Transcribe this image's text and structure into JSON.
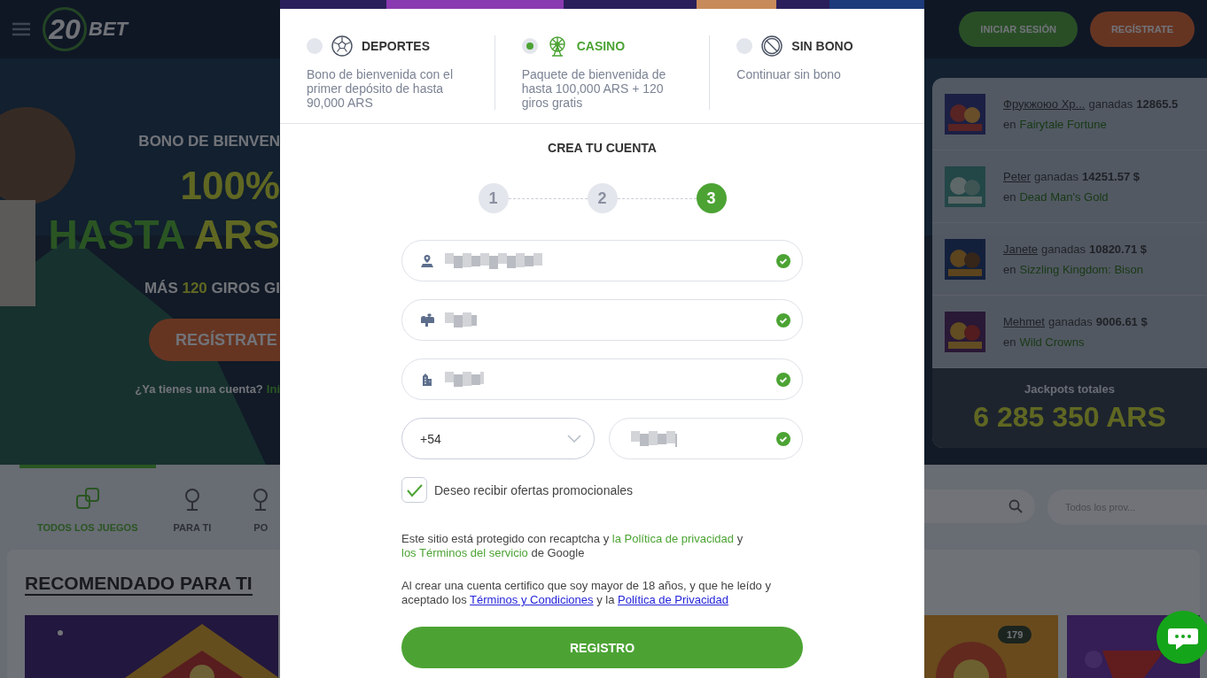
{
  "background_page": {
    "header": {
      "logo_number": "20",
      "logo_word": "BET",
      "login_button": "INICIAR SESIÓN",
      "register_button": "REGÍSTRATE"
    },
    "hero": {
      "eyebrow": "BONO DE BIENVEN",
      "percent": "100%",
      "amount_prefix": "HASTA",
      "amount_currency": "ARS",
      "spins": {
        "before": "MÁS ",
        "highlight": "120",
        "after": " GIROS GI"
      },
      "cta_button": "REGÍSTRATE",
      "login_prompt": "¿Ya tienes una cuenta?",
      "login_link": "Ini"
    },
    "winners": [
      {
        "name": "Фрукжоюо Хр...",
        "verb": "ganadas",
        "amount": "12865.5",
        "prefix": "en",
        "game": "Fairytale Fortune"
      },
      {
        "name": "Peter",
        "verb": "ganadas",
        "amount": "14251.57 $",
        "prefix": "en",
        "game": "Dead Man's Gold"
      },
      {
        "name": "Janete",
        "verb": "ganadas",
        "amount": "10820.71 $",
        "prefix": "en",
        "game": "Sizzling Kingdom: Bison"
      },
      {
        "name": "Mehmet",
        "verb": "ganadas",
        "amount": "9006.61 $",
        "prefix": "en",
        "game": "Wild Crowns"
      }
    ],
    "jackpot": {
      "label": "Jackpots totales",
      "amount": "6 285 350 ARS"
    },
    "category_tabs": [
      {
        "label": "TODOS LOS JUEGOS",
        "selected": true
      },
      {
        "label": "PARA TI",
        "selected": false
      },
      {
        "label": "PO",
        "selected": false
      }
    ],
    "provider_filter": {
      "placeholder": "Todos los prov..."
    },
    "section_title": "RECOMENDADO PARA TI",
    "game_badge": "179"
  },
  "modal": {
    "bonus_options": [
      {
        "kind": "sports",
        "title": "DEPORTES",
        "description": "Bono de bienvenida con el primer depósito de hasta 90,000 ARS",
        "selected": false
      },
      {
        "kind": "casino",
        "title": "CASINO",
        "description": "Paquete de bienvenida de hasta 100,000 ARS + 120 giros gratis",
        "selected": true
      },
      {
        "kind": "none",
        "title": "SIN BONO",
        "description": "Continuar sin bono",
        "selected": false
      }
    ],
    "title": "CREA TU CUENTA",
    "steps": [
      {
        "label": "1",
        "selected": false
      },
      {
        "label": "2",
        "selected": false
      },
      {
        "label": "3",
        "selected": true
      }
    ],
    "fields": [
      {
        "kind": "address",
        "valid": true
      },
      {
        "kind": "mailbox",
        "valid": true
      },
      {
        "kind": "city",
        "valid": true
      }
    ],
    "phone": {
      "code": "+54",
      "valid": true
    },
    "promo_checkbox": {
      "label": "Deseo recibir ofertas promocionales",
      "checked": true
    },
    "recaptcha_notice": [
      {
        "kind": "text",
        "text": "Este sitio está protegido con recaptcha y "
      },
      {
        "kind": "green-link",
        "text": "la Política de privacidad"
      },
      {
        "kind": "text",
        "text": " y "
      },
      {
        "kind": "green-link",
        "text": "los Términos del servicio"
      },
      {
        "kind": "text",
        "text": " de Google"
      }
    ],
    "consent_notice": [
      {
        "kind": "text",
        "text": "Al crear una cuenta certifico que soy mayor de 18 años, y que he leído y aceptado los "
      },
      {
        "kind": "blue-link",
        "text": "Términos y Condiciones"
      },
      {
        "kind": "text",
        "text": " y la "
      },
      {
        "kind": "blue-link",
        "text": "Política de Privacidad"
      }
    ],
    "submit_button": "REGISTRO"
  }
}
